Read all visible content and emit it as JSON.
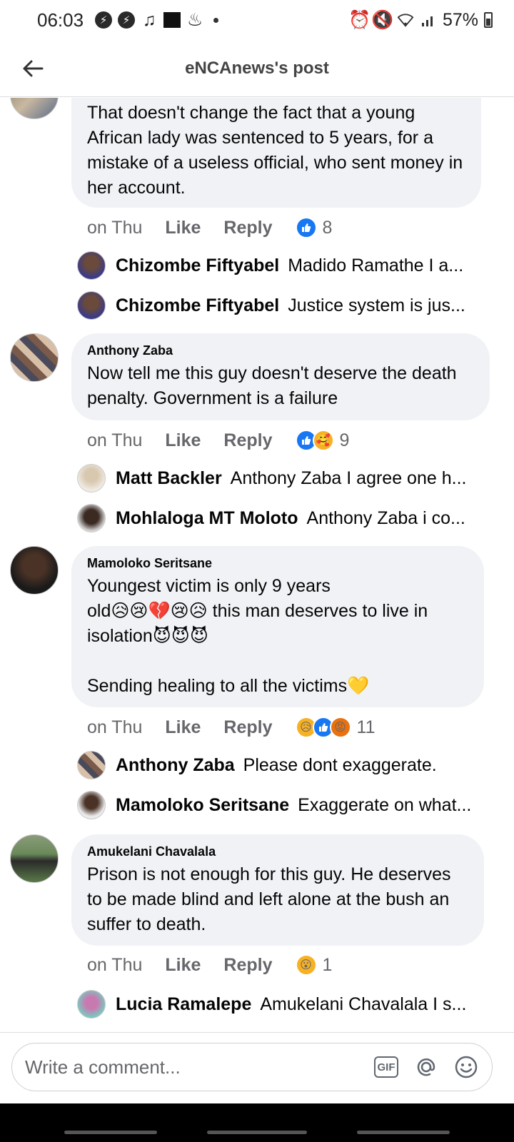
{
  "status_bar": {
    "time": "06:03",
    "battery": "57%"
  },
  "header": {
    "title": "eNCAnews's post"
  },
  "comments": [
    {
      "author": "",
      "text": "That doesn't change the fact that a young African lady was sentenced to 5 years, for a mistake of a useless official, who sent money in her account.",
      "time": "on Thu",
      "like": "Like",
      "reply": "Reply",
      "reaction_count": "8",
      "replies": [
        {
          "name": "Chizombe Fiftyabel",
          "text": "Madido Ramathe I a..."
        },
        {
          "name": "Chizombe Fiftyabel",
          "text": "Justice system is jus..."
        }
      ]
    },
    {
      "author": "Anthony Zaba",
      "text": "Now tell me this guy doesn't deserve the death penalty. Government is a failure",
      "time": "on Thu",
      "like": "Like",
      "reply": "Reply",
      "reaction_count": "9",
      "replies": [
        {
          "name": "Matt Backler",
          "text": "Anthony Zaba I agree one h..."
        },
        {
          "name": "Mohlaloga MT Moloto",
          "text": "Anthony Zaba i co..."
        }
      ]
    },
    {
      "author": "Mamoloko Seritsane",
      "text_line1": "Youngest victim is only 9 years",
      "text_line2": "old😥😢💔😢😥 this man deserves to live in",
      "text_line3": "isolation😈😈😈",
      "text_line4": "Sending healing to all the victims💛",
      "time": "on Thu",
      "like": "Like",
      "reply": "Reply",
      "reaction_count": "11",
      "replies": [
        {
          "name": "Anthony Zaba",
          "text": "Please dont exaggerate."
        },
        {
          "name": "Mamoloko Seritsane",
          "text": "Exaggerate on what..."
        }
      ]
    },
    {
      "author": "Amukelani Chavalala",
      "text": "Prison is not enough for this guy. He deserves to be made blind and left alone at the bush an suffer to death.",
      "time": "on Thu",
      "like": "Like",
      "reply": "Reply",
      "reaction_count": "1",
      "replies": [
        {
          "name": "Lucia Ramalepe",
          "text": "Amukelani Chavalala I s..."
        }
      ]
    }
  ],
  "composer": {
    "placeholder": "Write a comment...",
    "gif_label": "GIF"
  },
  "colors": {
    "bubble": "#f0f2f5",
    "like_blue": "#1877f2",
    "meta_gray": "#65676b"
  },
  "icons": [
    "back-arrow-icon",
    "gif-icon",
    "mention-icon",
    "emoji-icon",
    "like-reaction-icon",
    "care-reaction-icon",
    "sad-reaction-icon",
    "angry-reaction-icon",
    "wow-reaction-icon"
  ]
}
